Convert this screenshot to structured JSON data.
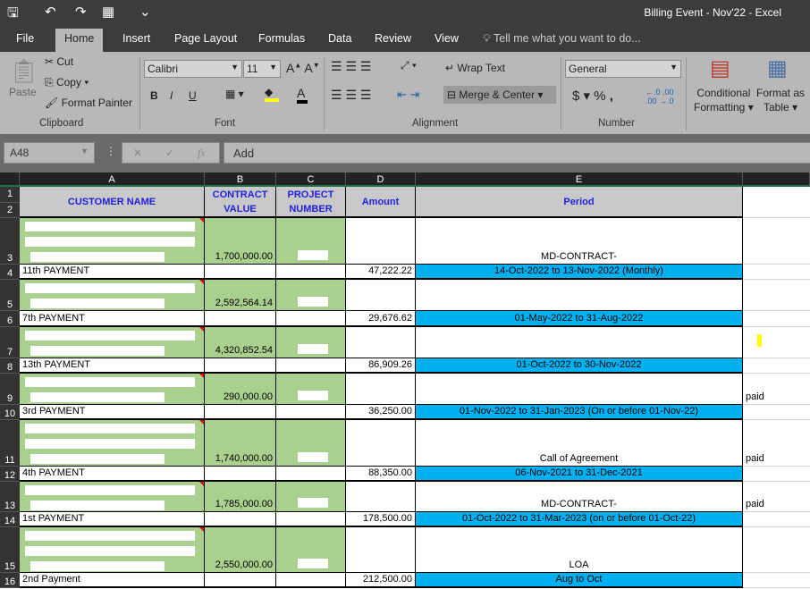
{
  "window": {
    "title": "Billing Event - Nov'22 - Excel"
  },
  "quick_access": [
    {
      "icon": "save-icon",
      "glyph": "🖫"
    },
    {
      "icon": "undo-icon",
      "glyph": "↶"
    },
    {
      "icon": "redo-icon",
      "glyph": "↷"
    },
    {
      "icon": "form-icon",
      "glyph": "▦"
    },
    {
      "icon": "customize-icon",
      "glyph": "⌄"
    }
  ],
  "tabs": [
    "File",
    "Home",
    "Insert",
    "Page Layout",
    "Formulas",
    "Data",
    "Review",
    "View"
  ],
  "tell_me": "Tell me what you want to do...",
  "ribbon": {
    "clipboard": {
      "paste": "Paste",
      "cut": "Cut",
      "copy": "Copy",
      "format_painter": "Format Painter",
      "label": "Clipboard"
    },
    "font": {
      "name": "Calibri",
      "size": "11",
      "bold": "B",
      "italic": "I",
      "underline": "U",
      "label": "Font",
      "fill_color": "#ffff00",
      "font_color": "#000000"
    },
    "alignment": {
      "wrap_text": "Wrap Text",
      "merge_center": "Merge & Center",
      "label": "Alignment"
    },
    "number": {
      "format": "General",
      "currency": "$",
      "percent": "%",
      "comma": ",",
      "label": "Number"
    },
    "styles": {
      "conditional": "Conditional",
      "formatting": "Formatting",
      "format_as": "Format as",
      "table": "Table"
    }
  },
  "formula_bar": {
    "name_box": "A48",
    "cancel": "✕",
    "enter": "✓",
    "fx": "fx",
    "value": "Add"
  },
  "columns": [
    "A",
    "B",
    "C",
    "D",
    "E"
  ],
  "header": {
    "customer": "CUSTOMER NAME",
    "contract": "CONTRACT VALUE",
    "project": "PROJECT NUMBER",
    "amount": "Amount",
    "period": "Period"
  },
  "rows": [
    {
      "n": "3",
      "type": "customer",
      "contract": "1,700,000.00",
      "period": "MD-CONTRACT-"
    },
    {
      "n": "4",
      "type": "payment",
      "name": "11th PAYMENT",
      "amount": "47,222.22",
      "period": "14-Oct-2022 to 13-Nov-2022 (Monthly)"
    },
    {
      "n": "5",
      "type": "customer",
      "contract": "2,592,564.14",
      "period": ""
    },
    {
      "n": "6",
      "type": "payment",
      "name": "7th PAYMENT",
      "amount": "29,676.62",
      "period": "01-May-2022 to 31-Aug-2022"
    },
    {
      "n": "7",
      "type": "customer",
      "contract": "4,320,852.54",
      "period": ""
    },
    {
      "n": "8",
      "type": "payment",
      "name": "13th PAYMENT",
      "amount": "86,909.26",
      "period": "01-Oct-2022 to 30-Nov-2022"
    },
    {
      "n": "9",
      "type": "customer",
      "contract": "290,000.00",
      "period": "",
      "note": "paid"
    },
    {
      "n": "10",
      "type": "payment",
      "name": "3rd PAYMENT",
      "amount": "36,250.00",
      "period": "01-Nov-2022 to 31-Jan-2023 (On or before 01-Nov-22)"
    },
    {
      "n": "11",
      "type": "customer",
      "contract": "1,740,000.00",
      "period": "Call of Agreement",
      "note": "paid"
    },
    {
      "n": "12",
      "type": "payment",
      "name": "4th PAYMENT",
      "amount": "88,350.00",
      "period": "06-Nov-2021 to 31-Dec-2021"
    },
    {
      "n": "13",
      "type": "customer",
      "contract": "1,785,000.00",
      "period": "MD-CONTRACT-",
      "note": "paid"
    },
    {
      "n": "14",
      "type": "payment",
      "name": "1st PAYMENT",
      "amount": "178,500.00",
      "period": "01-Oct-2022 to 31-Mar-2023 (on or before 01-Oct-22)"
    },
    {
      "n": "15",
      "type": "customer",
      "contract": "2,550,000.00",
      "period": "LOA"
    },
    {
      "n": "16",
      "type": "payment",
      "name": "2nd Payment",
      "amount": "212,500.00",
      "period": "Aug to Oct"
    }
  ],
  "colors": {
    "customer_fill": "#a9d08e",
    "period_fill": "#00b0f0",
    "header_fill": "#c9c9c9",
    "header_text": "#1f1fe0"
  }
}
